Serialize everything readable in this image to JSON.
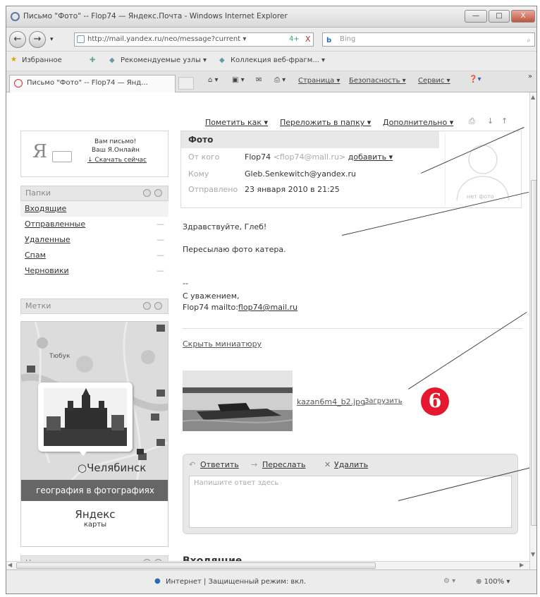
{
  "window": {
    "title": "Письмо \"Фото\" -- Flop74 — Яндекс.Почта - Windows Internet Explorer",
    "buttons": [
      "—",
      "□",
      "X"
    ]
  },
  "nav": {
    "back_icon": "back-arrow-icon",
    "forward_icon": "forward-arrow-icon",
    "address": "http://mail.yandex.ru/neo/message?current ▾",
    "search_placeholder": "Bing",
    "refresh": "4+",
    "stop": "X"
  },
  "favorites": {
    "label": "Избранное",
    "items": [
      "Рекомендуемые узлы ▾",
      "Коллекция веб-фрагм... ▾"
    ]
  },
  "tab": {
    "label": "Письмо \"Фото\" -- Flop74 — Янд...",
    "toolbar": [
      "Страница ▾",
      "Безопасность ▾",
      "Сервис ▾"
    ]
  },
  "mail_toolbar": {
    "mark_as": "Пометить как ▾",
    "move_to": "Переложить в папку ▾",
    "more": "Дополнительно ▾"
  },
  "promo": {
    "line1": "Вам письмо!",
    "line2": "Ваш Я.Онлайн",
    "link": "Скачать сейчас"
  },
  "folders": {
    "header": "Папки",
    "items": [
      {
        "label": "Входящие",
        "count": ""
      },
      {
        "label": "Отправленные",
        "count": "—"
      },
      {
        "label": "Удаленные",
        "count": "—"
      },
      {
        "label": "Спам",
        "count": "—"
      },
      {
        "label": "Черновики",
        "count": "—"
      }
    ]
  },
  "labels": {
    "header": "Метки"
  },
  "map": {
    "city_top": "Тюбук",
    "city_main": "Челябинск",
    "banner": "география в фотографиях",
    "logo_top": "Яндекс",
    "logo_bottom": "карты"
  },
  "news": {
    "header": "Новости"
  },
  "message": {
    "subject": "Фото",
    "from_label": "От кого",
    "from_name": "Flop74",
    "from_email": "<flop74@mail.ru>",
    "add": "добавить ▾",
    "to_label": "Кому",
    "to_value": "Gleb.Senkewitch@yandex.ru",
    "sent_label": "Отправлено",
    "sent_value": "23 января 2010 в 21:25",
    "no_photo": "нет фото",
    "greeting": "Здравствуйте, Глеб!",
    "text": "Пересылаю фото катера.",
    "dash": "--",
    "regards": "С уважением,",
    "signature": "Flop74 mailto:",
    "signature_link": "flop74@mail.ru",
    "hide_thumb": "Скрыть миниатюру",
    "attachment": "kazan6m4_b2.jpg",
    "download": "Загрузить",
    "callout": "6"
  },
  "reply": {
    "reply_label": "Ответить",
    "forward_label": "Переслать",
    "delete_label": "Удалить",
    "placeholder": "Напишите ответ здесь"
  },
  "inbox_heading": "Входящие",
  "statusbar": {
    "zone": "Интернет | Защищенный режим: вкл.",
    "zoom": "100%"
  }
}
